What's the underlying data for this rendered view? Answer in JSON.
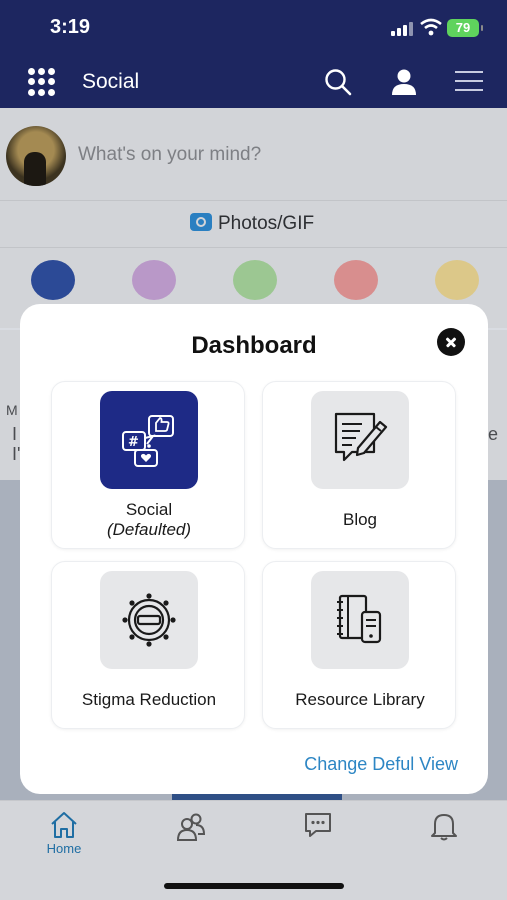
{
  "status_bar": {
    "time": "3:19",
    "battery": "79"
  },
  "header": {
    "title": "Social",
    "icons": [
      "apps-grid-icon",
      "search-icon",
      "user-icon",
      "hamburger-menu-icon"
    ]
  },
  "composer": {
    "placeholder": "What's on your mind?",
    "photos_label": "Photos/GIF"
  },
  "categories": [
    {
      "icon": "globe-icon",
      "color": "#2c4a96"
    },
    {
      "icon": "lock-icon",
      "color": "#b998c8"
    },
    {
      "icon": "image-icon",
      "color": "#9cc792"
    },
    {
      "icon": "save-icon",
      "color": "#d88e8e"
    },
    {
      "icon": "newspaper-icon",
      "color": "#dcc889"
    }
  ],
  "post_partial": {
    "left_letters": [
      "M",
      "I",
      "I'"
    ],
    "right_letter": "e"
  },
  "modal": {
    "title": "Dashboard",
    "cards": [
      {
        "label": "Social",
        "sublabel": "(Defaulted)",
        "icon": "social-chat-icon",
        "active": true
      },
      {
        "label": "Blog",
        "icon": "blog-edit-icon",
        "active": false
      },
      {
        "label": "Stigma Reduction",
        "icon": "stigma-badge-icon",
        "active": false
      },
      {
        "label": "Resource Library",
        "icon": "resource-library-icon",
        "active": false
      }
    ],
    "change_link": "Change Deful View"
  },
  "tabbar": {
    "tabs": [
      {
        "label": "Home",
        "icon": "home-icon",
        "active": true
      },
      {
        "label": "",
        "icon": "people-icon",
        "active": false
      },
      {
        "label": "",
        "icon": "chat-icon",
        "active": false
      },
      {
        "label": "",
        "icon": "bell-icon",
        "active": false
      }
    ]
  },
  "colors": {
    "header_bg": "#1d2660",
    "active_tile": "#1e2a86",
    "link": "#2d86c4",
    "tab_active": "#1f6ea3"
  }
}
